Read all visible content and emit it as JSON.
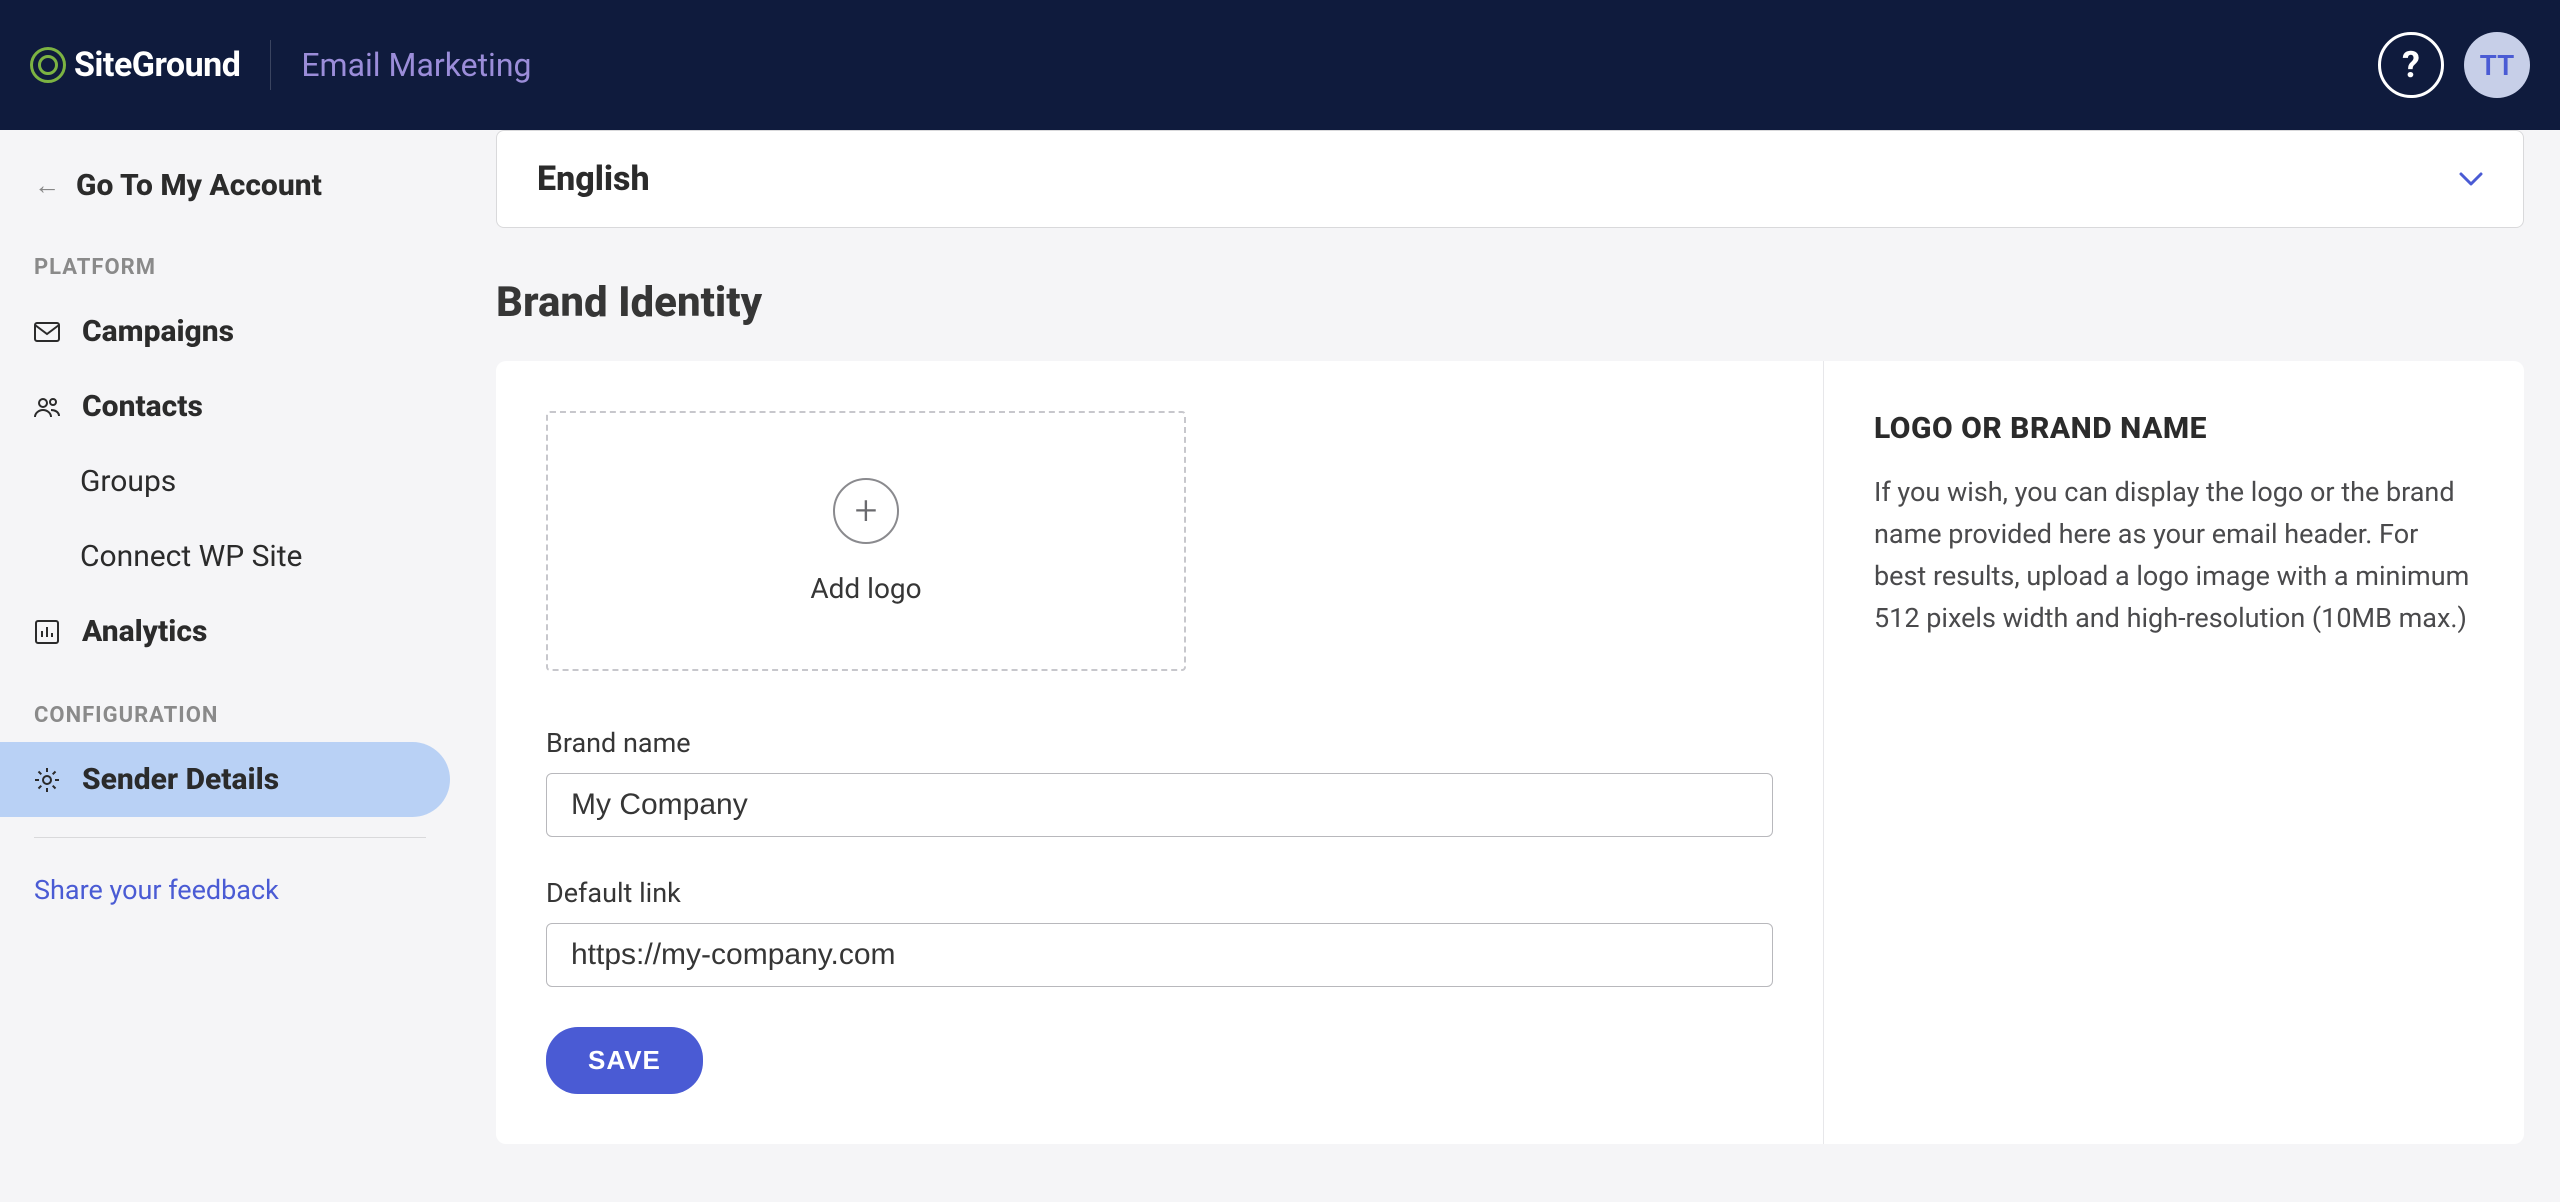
{
  "header": {
    "logo_text": "SiteGround",
    "app_title": "Email Marketing",
    "avatar_initials": "TT",
    "help_symbol": "?"
  },
  "sidebar": {
    "back_label": "Go To My Account",
    "sections": {
      "platform_label": "PLATFORM",
      "configuration_label": "CONFIGURATION"
    },
    "items": {
      "campaigns": "Campaigns",
      "contacts": "Contacts",
      "groups": "Groups",
      "connect_wp": "Connect WP Site",
      "analytics": "Analytics",
      "sender_details": "Sender Details"
    },
    "feedback": "Share your feedback"
  },
  "main": {
    "language_selected": "English",
    "section_title": "Brand Identity",
    "upload_label": "Add logo",
    "plus_glyph": "+",
    "brand_name_label": "Brand name",
    "brand_name_value": "My Company",
    "default_link_label": "Default link",
    "default_link_value": "https://my-company.com",
    "save_button": "SAVE",
    "panel_title": "LOGO OR BRAND NAME",
    "panel_text": "If you wish, you can display the logo or the brand name provided here as your email header. For best results, upload a logo image with a minimum 512 pixels width and high-resolution (10MB max.)"
  }
}
